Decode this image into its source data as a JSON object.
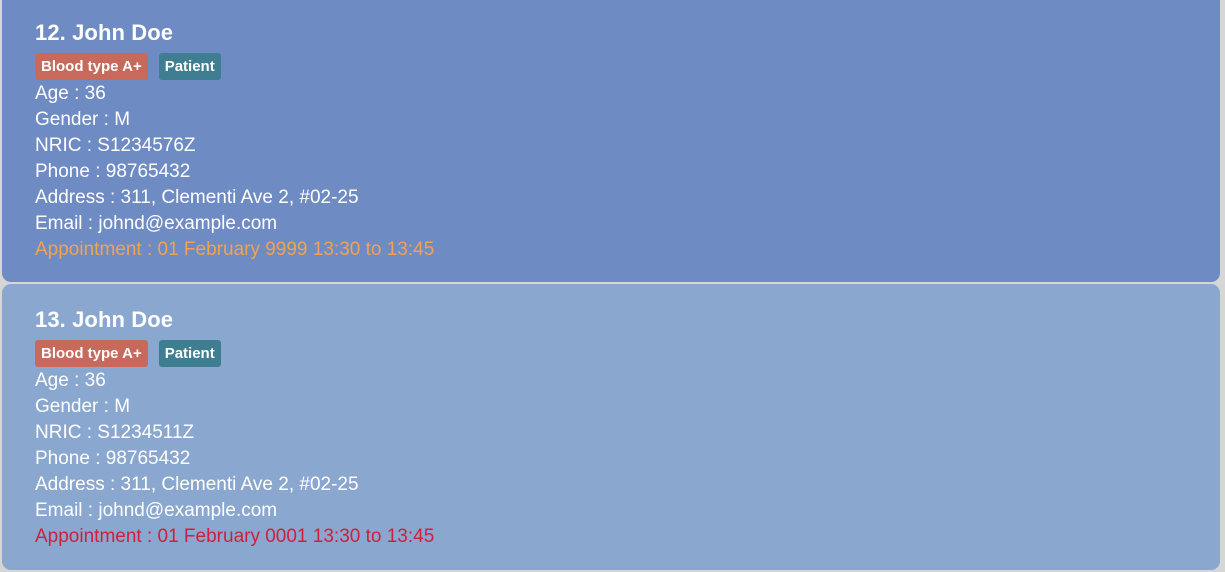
{
  "persons": [
    {
      "index_name": "12. John Doe",
      "tags": [
        "Blood type A+",
        "Patient"
      ],
      "age": "Age : 36",
      "gender": "Gender : M",
      "nric": "NRIC : S1234576Z",
      "phone": "Phone : 98765432",
      "address": "Address : 311, Clementi Ave 2, #02-25",
      "email": "Email : johnd@example.com",
      "appointment": "Appointment : 01 February 9999 13:30 to 13:45"
    },
    {
      "index_name": "13. John Doe",
      "tags": [
        "Blood type A+",
        "Patient"
      ],
      "age": "Age : 36",
      "gender": "Gender : M",
      "nric": "NRIC : S1234511Z",
      "phone": "Phone : 98765432",
      "address": "Address : 311, Clementi Ave 2, #02-25",
      "email": "Email : johnd@example.com",
      "appointment": "Appointment : 01 February 0001 13:30 to 13:45"
    }
  ],
  "colors": {
    "card_selected": "#6f8bc3",
    "card_default": "#8aa7cf",
    "tag_blood": "#c76a5c",
    "tag_role": "#3f7d91",
    "appointment_upcoming": "#f0a350",
    "appointment_past": "#d01f3c"
  }
}
